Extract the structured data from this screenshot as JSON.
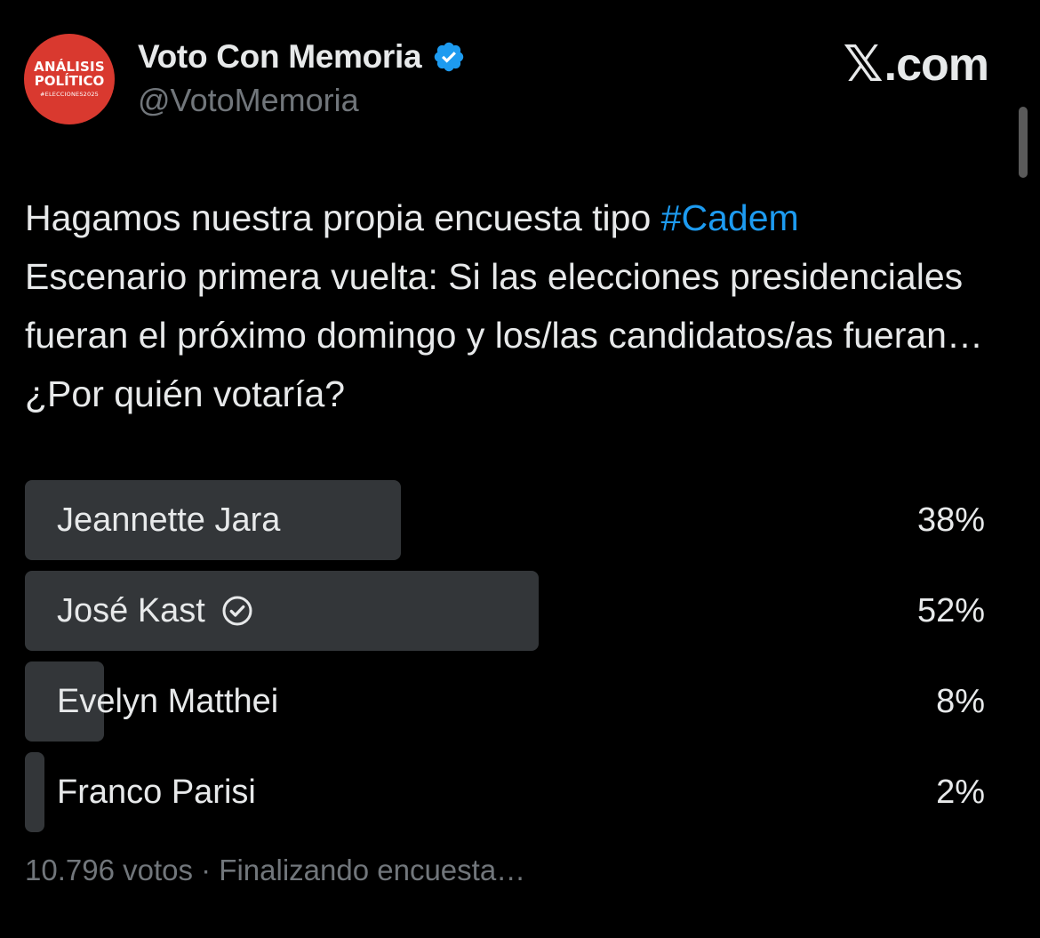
{
  "account": {
    "avatar_lines": [
      "ANÁLISIS",
      "POLÍTICO",
      "#ELECCIONES2025"
    ],
    "display_name": "Voto Con Memoria",
    "handle": "@VotoMemoria",
    "verified_color": "#1d9bf0",
    "verified_icon": "verified-badge-icon"
  },
  "brand": {
    "x_glyph": "𝕏",
    "site": ".com"
  },
  "tweet": {
    "text_before": "Hagamos nuestra propia encuesta tipo ",
    "hashtag": "#Cadem",
    "text_after": "Escenario primera vuelta: Si las elecciones presidenciales fueran el próximo domingo y los/las candidatos/as fueran… ¿Por quién votaría?"
  },
  "poll": {
    "options": [
      {
        "label": "Jeannette Jara",
        "percent_text": "38%",
        "percent": 38,
        "winner": false
      },
      {
        "label": "José Kast",
        "percent_text": "52%",
        "percent": 52,
        "winner": true
      },
      {
        "label": "Evelyn Matthei",
        "percent_text": "8%",
        "percent": 8,
        "winner": false
      },
      {
        "label": "Franco Parisi",
        "percent_text": "2%",
        "percent": 2,
        "winner": false
      }
    ],
    "footer": "10.796 votos · Finalizando encuesta…"
  },
  "colors": {
    "background": "#000000",
    "text": "#e7e9ea",
    "muted": "#71767b",
    "link": "#1d9bf0",
    "bar": "#333639",
    "avatar_bg": "#d9392f"
  }
}
